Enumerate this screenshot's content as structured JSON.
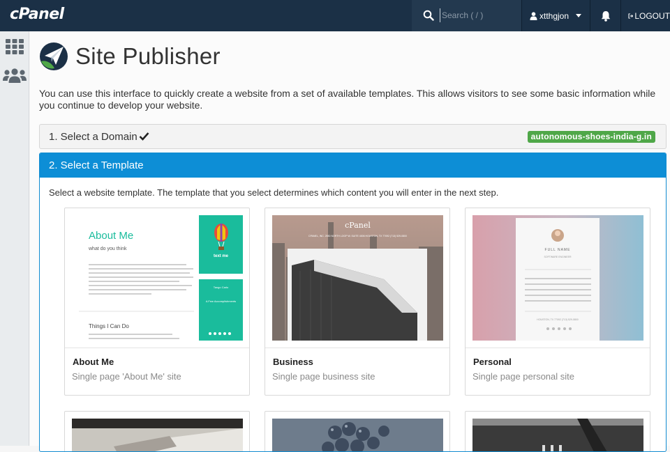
{
  "topbar": {
    "brand": "cPanel",
    "search_placeholder": "Search ( / )",
    "username": "xtthgjon",
    "logout_label": "LOGOUT"
  },
  "sidebar": {
    "items": [
      {
        "icon": "grid-icon",
        "label": "Home"
      },
      {
        "icon": "users-icon",
        "label": "Users"
      }
    ]
  },
  "page": {
    "title": "Site Publisher",
    "intro": "You can use this interface to quickly create a website from a set of available templates. This allows visitors to see some basic information while you continue to develop your website."
  },
  "steps": {
    "step1_title": "1. Select a Domain",
    "domain": "autonomous-shoes-india-g.in",
    "step2_title": "2. Select a Template",
    "step2_desc": "Select a website template. The template that you select determines which content you will enter in the next step."
  },
  "templates": [
    {
      "name": "About Me",
      "desc": "Single page 'About Me' site",
      "preview": {
        "heading": "About Me",
        "subheading": "what do you think",
        "section": "Things I Can Do",
        "panel_title": "text me",
        "panel_name": "Tango Carlo",
        "panel_footer": "A Few Accomplishments"
      }
    },
    {
      "name": "Business",
      "desc": "Single page business site",
      "preview": {
        "brand": "cPanel",
        "address": "CPANEL, INC. 2550 NORTH LOOP W. SUITE 4006 HOUSTON, TX 77092 (713) 529-0800"
      }
    },
    {
      "name": "Personal",
      "desc": "Single page personal site",
      "preview": {
        "full_name": "FULL NAME",
        "tagline": "SOFTWARE ENGINEER",
        "location": "HOUSTON, TX 77092 (713) 529-0800"
      }
    }
  ],
  "colors": {
    "topbar": "#1b3046",
    "accent": "#0d8ed6",
    "success": "#4fa748",
    "teal": "#1abc9c"
  }
}
